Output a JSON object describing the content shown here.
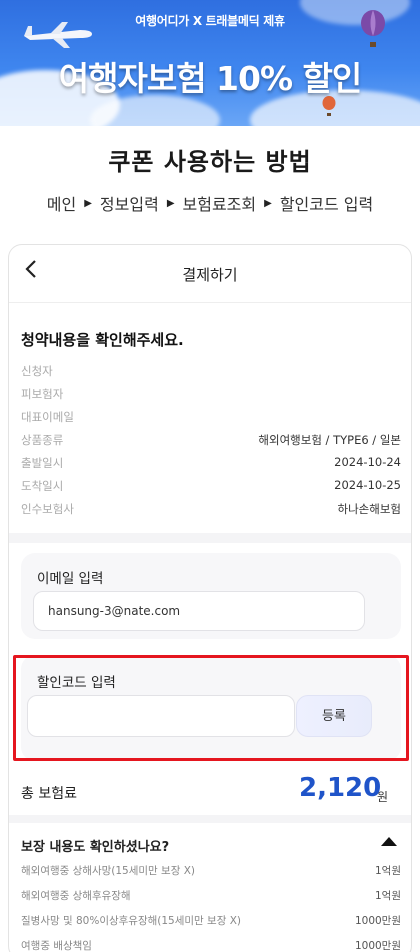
{
  "banner": {
    "subtitle": "여행어디가 X 트래블메딕 제휴",
    "title": "여행자보험  10% 할인"
  },
  "guide": {
    "title": "쿠폰 사용하는 방법",
    "steps": [
      "메인",
      "정보입력",
      "보험료조회",
      "할인코드 입력"
    ]
  },
  "payment": {
    "header_title": "결제하기",
    "back_icon": "chevron-left-icon",
    "confirm_text": "청약내용을 확인해주세요.",
    "rows": [
      {
        "label": "신청자",
        "value": ""
      },
      {
        "label": "피보험자",
        "value": ""
      },
      {
        "label": "대표이메일",
        "value": ""
      },
      {
        "label": "상품종류",
        "value": "해외여행보험 / TYPE6 / 일본"
      },
      {
        "label": "출발일시",
        "value": "2024-10-24"
      },
      {
        "label": "도착일시",
        "value": "2024-10-25"
      },
      {
        "label": "인수보험사",
        "value": "하나손해보험"
      }
    ],
    "email": {
      "label": "이메일 입력",
      "value": "hansung-3@nate.com"
    },
    "discount": {
      "label": "할인코드 입력",
      "value": "",
      "button": "등록"
    },
    "total": {
      "label": "총 보험료",
      "amount": "2,120",
      "unit": "원"
    },
    "coverage": {
      "title": "보장 내용도 확인하셨나요?",
      "rows": [
        {
          "label": "해외여행중 상해사망(15세미만 보장 X)",
          "value": "1억원"
        },
        {
          "label": "해외여행중 상해후유장해",
          "value": "1억원"
        },
        {
          "label": "질병사망 및 80%이상후유장해(15세미만 보장 X)",
          "value": "1000만원"
        },
        {
          "label": "여행중 배상책임",
          "value": "1000만원"
        }
      ]
    }
  },
  "colors": {
    "banner_blue": "#3f86ef",
    "total_blue": "#1f54c9",
    "highlight_red": "#e5161f"
  }
}
